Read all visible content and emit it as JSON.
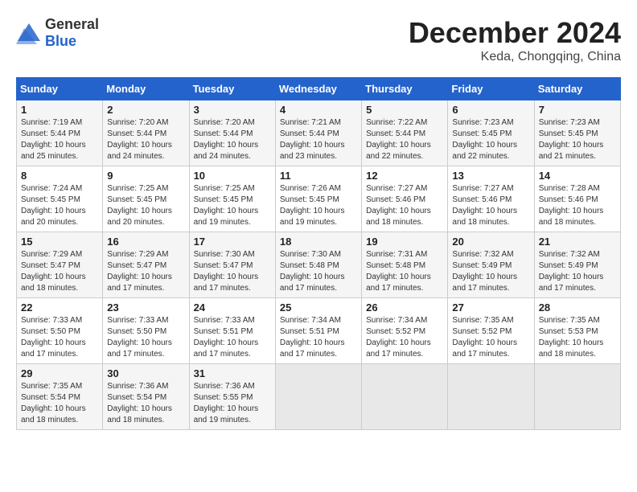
{
  "logo": {
    "text_general": "General",
    "text_blue": "Blue"
  },
  "title": "December 2024",
  "location": "Keda, Chongqing, China",
  "days_of_week": [
    "Sunday",
    "Monday",
    "Tuesday",
    "Wednesday",
    "Thursday",
    "Friday",
    "Saturday"
  ],
  "weeks": [
    [
      {
        "day": "1",
        "sunrise": "Sunrise: 7:19 AM",
        "sunset": "Sunset: 5:44 PM",
        "daylight": "Daylight: 10 hours and 25 minutes."
      },
      {
        "day": "2",
        "sunrise": "Sunrise: 7:20 AM",
        "sunset": "Sunset: 5:44 PM",
        "daylight": "Daylight: 10 hours and 24 minutes."
      },
      {
        "day": "3",
        "sunrise": "Sunrise: 7:20 AM",
        "sunset": "Sunset: 5:44 PM",
        "daylight": "Daylight: 10 hours and 24 minutes."
      },
      {
        "day": "4",
        "sunrise": "Sunrise: 7:21 AM",
        "sunset": "Sunset: 5:44 PM",
        "daylight": "Daylight: 10 hours and 23 minutes."
      },
      {
        "day": "5",
        "sunrise": "Sunrise: 7:22 AM",
        "sunset": "Sunset: 5:44 PM",
        "daylight": "Daylight: 10 hours and 22 minutes."
      },
      {
        "day": "6",
        "sunrise": "Sunrise: 7:23 AM",
        "sunset": "Sunset: 5:45 PM",
        "daylight": "Daylight: 10 hours and 22 minutes."
      },
      {
        "day": "7",
        "sunrise": "Sunrise: 7:23 AM",
        "sunset": "Sunset: 5:45 PM",
        "daylight": "Daylight: 10 hours and 21 minutes."
      }
    ],
    [
      {
        "day": "8",
        "sunrise": "Sunrise: 7:24 AM",
        "sunset": "Sunset: 5:45 PM",
        "daylight": "Daylight: 10 hours and 20 minutes."
      },
      {
        "day": "9",
        "sunrise": "Sunrise: 7:25 AM",
        "sunset": "Sunset: 5:45 PM",
        "daylight": "Daylight: 10 hours and 20 minutes."
      },
      {
        "day": "10",
        "sunrise": "Sunrise: 7:25 AM",
        "sunset": "Sunset: 5:45 PM",
        "daylight": "Daylight: 10 hours and 19 minutes."
      },
      {
        "day": "11",
        "sunrise": "Sunrise: 7:26 AM",
        "sunset": "Sunset: 5:45 PM",
        "daylight": "Daylight: 10 hours and 19 minutes."
      },
      {
        "day": "12",
        "sunrise": "Sunrise: 7:27 AM",
        "sunset": "Sunset: 5:46 PM",
        "daylight": "Daylight: 10 hours and 18 minutes."
      },
      {
        "day": "13",
        "sunrise": "Sunrise: 7:27 AM",
        "sunset": "Sunset: 5:46 PM",
        "daylight": "Daylight: 10 hours and 18 minutes."
      },
      {
        "day": "14",
        "sunrise": "Sunrise: 7:28 AM",
        "sunset": "Sunset: 5:46 PM",
        "daylight": "Daylight: 10 hours and 18 minutes."
      }
    ],
    [
      {
        "day": "15",
        "sunrise": "Sunrise: 7:29 AM",
        "sunset": "Sunset: 5:47 PM",
        "daylight": "Daylight: 10 hours and 18 minutes."
      },
      {
        "day": "16",
        "sunrise": "Sunrise: 7:29 AM",
        "sunset": "Sunset: 5:47 PM",
        "daylight": "Daylight: 10 hours and 17 minutes."
      },
      {
        "day": "17",
        "sunrise": "Sunrise: 7:30 AM",
        "sunset": "Sunset: 5:47 PM",
        "daylight": "Daylight: 10 hours and 17 minutes."
      },
      {
        "day": "18",
        "sunrise": "Sunrise: 7:30 AM",
        "sunset": "Sunset: 5:48 PM",
        "daylight": "Daylight: 10 hours and 17 minutes."
      },
      {
        "day": "19",
        "sunrise": "Sunrise: 7:31 AM",
        "sunset": "Sunset: 5:48 PM",
        "daylight": "Daylight: 10 hours and 17 minutes."
      },
      {
        "day": "20",
        "sunrise": "Sunrise: 7:32 AM",
        "sunset": "Sunset: 5:49 PM",
        "daylight": "Daylight: 10 hours and 17 minutes."
      },
      {
        "day": "21",
        "sunrise": "Sunrise: 7:32 AM",
        "sunset": "Sunset: 5:49 PM",
        "daylight": "Daylight: 10 hours and 17 minutes."
      }
    ],
    [
      {
        "day": "22",
        "sunrise": "Sunrise: 7:33 AM",
        "sunset": "Sunset: 5:50 PM",
        "daylight": "Daylight: 10 hours and 17 minutes."
      },
      {
        "day": "23",
        "sunrise": "Sunrise: 7:33 AM",
        "sunset": "Sunset: 5:50 PM",
        "daylight": "Daylight: 10 hours and 17 minutes."
      },
      {
        "day": "24",
        "sunrise": "Sunrise: 7:33 AM",
        "sunset": "Sunset: 5:51 PM",
        "daylight": "Daylight: 10 hours and 17 minutes."
      },
      {
        "day": "25",
        "sunrise": "Sunrise: 7:34 AM",
        "sunset": "Sunset: 5:51 PM",
        "daylight": "Daylight: 10 hours and 17 minutes."
      },
      {
        "day": "26",
        "sunrise": "Sunrise: 7:34 AM",
        "sunset": "Sunset: 5:52 PM",
        "daylight": "Daylight: 10 hours and 17 minutes."
      },
      {
        "day": "27",
        "sunrise": "Sunrise: 7:35 AM",
        "sunset": "Sunset: 5:52 PM",
        "daylight": "Daylight: 10 hours and 17 minutes."
      },
      {
        "day": "28",
        "sunrise": "Sunrise: 7:35 AM",
        "sunset": "Sunset: 5:53 PM",
        "daylight": "Daylight: 10 hours and 18 minutes."
      }
    ],
    [
      {
        "day": "29",
        "sunrise": "Sunrise: 7:35 AM",
        "sunset": "Sunset: 5:54 PM",
        "daylight": "Daylight: 10 hours and 18 minutes."
      },
      {
        "day": "30",
        "sunrise": "Sunrise: 7:36 AM",
        "sunset": "Sunset: 5:54 PM",
        "daylight": "Daylight: 10 hours and 18 minutes."
      },
      {
        "day": "31",
        "sunrise": "Sunrise: 7:36 AM",
        "sunset": "Sunset: 5:55 PM",
        "daylight": "Daylight: 10 hours and 19 minutes."
      },
      null,
      null,
      null,
      null
    ]
  ]
}
